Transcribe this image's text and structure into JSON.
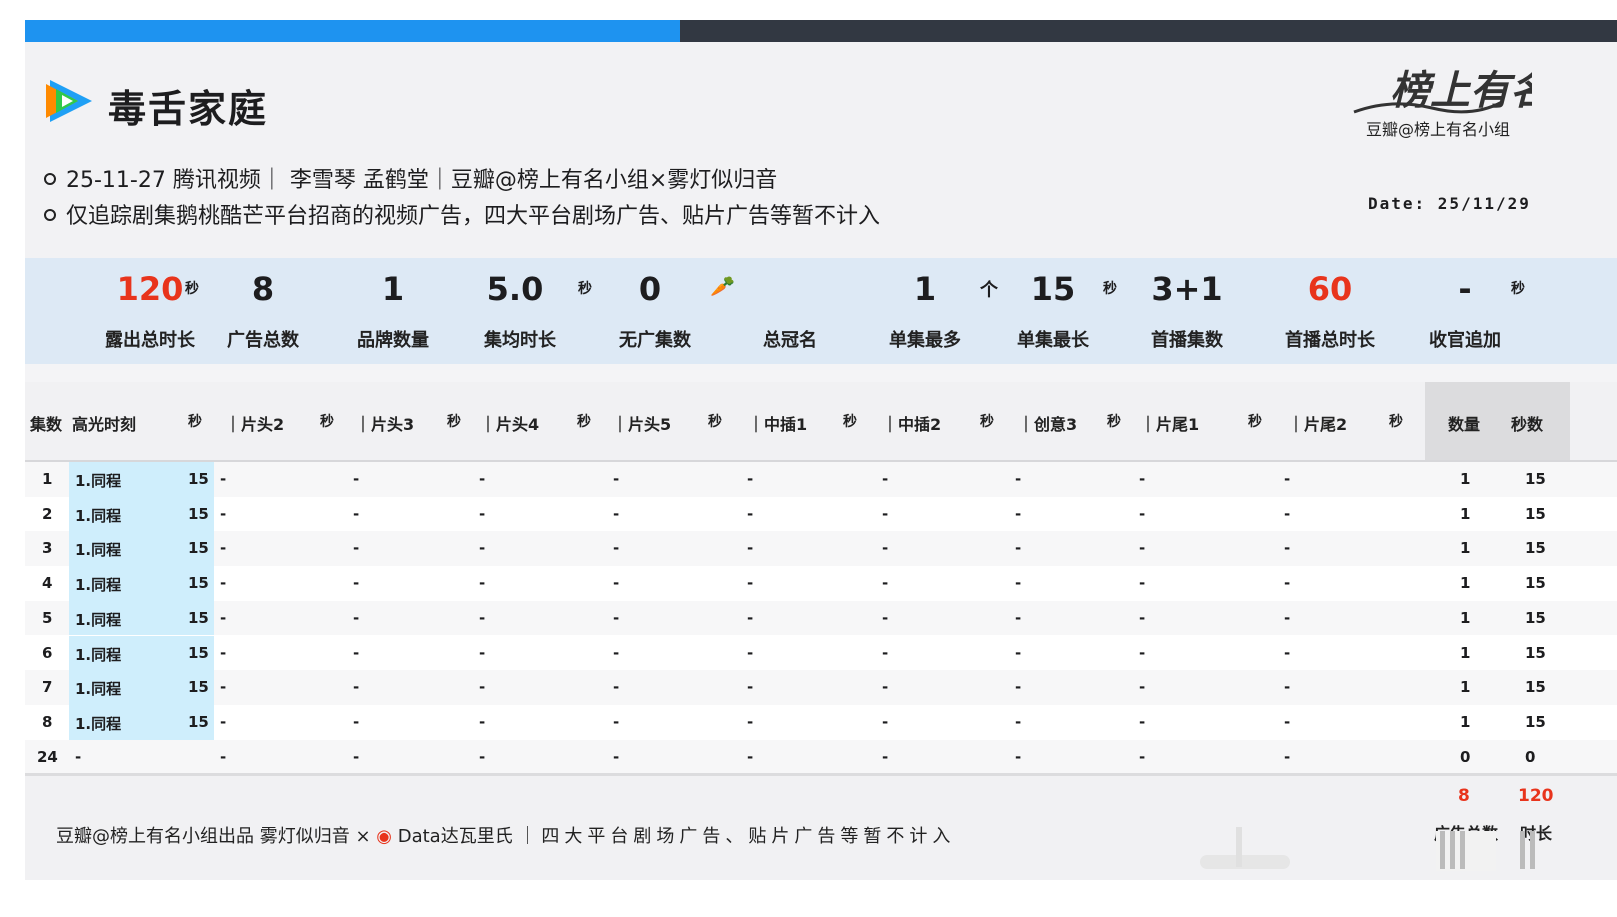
{
  "header": {
    "title": "毒舌家庭",
    "info_line1": "25-11-27 腾讯视频｜ 李雪琴 孟鹤堂｜豆瓣@榜上有名小组×雾灯似归音",
    "info_line2": "仅追踪剧集鹅桃酷芒平台招商的视频广告，四大平台剧场广告、贴片广告等暂不计入",
    "brand_logo_text": "榜上有名",
    "brand_sub": "豆瓣@榜上有名小组",
    "date": "Date: 25/11/29"
  },
  "stats": [
    {
      "value": "120",
      "unit": "秒",
      "label": "露出总时长",
      "red": true
    },
    {
      "value": "8",
      "unit": "",
      "label": "广告总数",
      "red": false
    },
    {
      "value": "1",
      "unit": "",
      "label": "品牌数量",
      "red": false
    },
    {
      "value": "5.0",
      "unit": "秒",
      "label": "集均时长",
      "red": false
    },
    {
      "value": "0",
      "unit": "🥕",
      "label": "无广集数",
      "red": false
    },
    {
      "value": "",
      "unit": "",
      "label": "总冠名",
      "red": false
    },
    {
      "value": "1",
      "unit": "个",
      "label": "单集最多",
      "red": false
    },
    {
      "value": "15",
      "unit": "秒",
      "label": "单集最长",
      "red": false
    },
    {
      "value": "3+1",
      "unit": "",
      "label": "首播集数",
      "red": false
    },
    {
      "value": "60",
      "unit": "",
      "label": "首播总时长",
      "red": true
    },
    {
      "value": "-",
      "unit": "秒",
      "label": "收官追加",
      "red": false
    }
  ],
  "table": {
    "headers": [
      "集数",
      "高光时刻",
      "秒",
      "｜片头2",
      "秒",
      "｜片头3",
      "秒",
      "｜片头4",
      "秒",
      "｜片头5",
      "秒",
      "｜中插1",
      "秒",
      "｜中插2",
      "秒",
      "｜创意3",
      "秒",
      "｜片尾1",
      "秒",
      "｜片尾2",
      "秒",
      "数量",
      "秒数"
    ],
    "rows": [
      {
        "ep": "1",
        "hl": "1.同程",
        "hl_sec": "15",
        "dash": "-",
        "count": "1",
        "secs": "15"
      },
      {
        "ep": "2",
        "hl": "1.同程",
        "hl_sec": "15",
        "dash": "-",
        "count": "1",
        "secs": "15"
      },
      {
        "ep": "3",
        "hl": "1.同程",
        "hl_sec": "15",
        "dash": "-",
        "count": "1",
        "secs": "15"
      },
      {
        "ep": "4",
        "hl": "1.同程",
        "hl_sec": "15",
        "dash": "-",
        "count": "1",
        "secs": "15"
      },
      {
        "ep": "5",
        "hl": "1.同程",
        "hl_sec": "15",
        "dash": "-",
        "count": "1",
        "secs": "15"
      },
      {
        "ep": "6",
        "hl": "1.同程",
        "hl_sec": "15",
        "dash": "-",
        "count": "1",
        "secs": "15"
      },
      {
        "ep": "7",
        "hl": "1.同程",
        "hl_sec": "15",
        "dash": "-",
        "count": "1",
        "secs": "15"
      },
      {
        "ep": "8",
        "hl": "1.同程",
        "hl_sec": "15",
        "dash": "-",
        "count": "1",
        "secs": "15"
      },
      {
        "ep": "24",
        "hl": "-",
        "hl_sec": "",
        "dash": "-",
        "count": "0",
        "secs": "0"
      }
    ]
  },
  "footer": {
    "credit": "豆瓣@榜上有名小组出品  雾灯似归音 ×",
    "credit2": "Data达瓦里氏",
    "note": "｜四大平台剧场广告、贴片广告等暂不计入",
    "total_count": "8",
    "total_secs": "120",
    "total_count_label": "广告总数",
    "total_secs_label": "时长"
  },
  "colors": {
    "accent_blue": "#1e93f0",
    "dark_bar": "#323842",
    "highlight": "#e8341c",
    "stats_bg": "#dde9f5",
    "hl_col": "#cfeefc"
  }
}
